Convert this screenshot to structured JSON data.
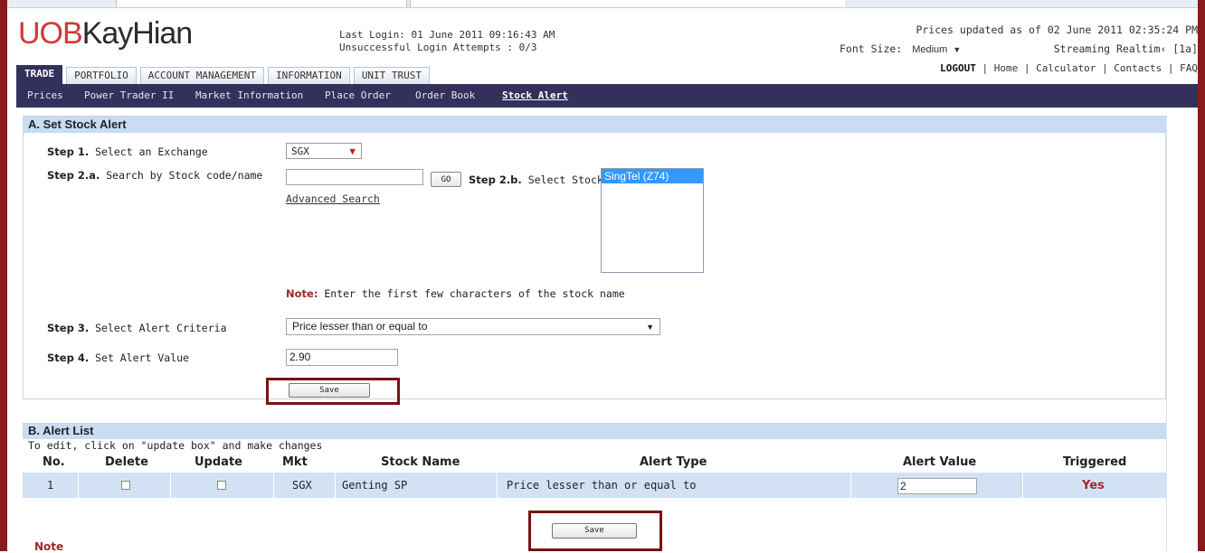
{
  "header": {
    "logo_part1": "UOB",
    "logo_part2": "KayHian",
    "last_login": "Last Login: 01 June 2011 09:16:43 AM",
    "unsuccessful": "Unsuccessful Login Attempts : 0/3",
    "prices_updated": "Prices updated as of 02 June 2011 02:35:24 PM",
    "font_size_label": "Font Size:",
    "font_size_value": "Medium",
    "streaming": "Streaming Realtim‹ [1a]",
    "links": {
      "logout": "LOGOUT",
      "home": "Home",
      "calculator": "Calculator",
      "contacts": "Contacts",
      "faq": "FAQ"
    }
  },
  "tabs": [
    "TRADE",
    "PORTFOLIO",
    "ACCOUNT MANAGEMENT",
    "INFORMATION",
    "UNIT TRUST"
  ],
  "subnav": [
    "Prices",
    "Power Trader II",
    "Market Information",
    "Place Order",
    "Order Book",
    "Stock Alert"
  ],
  "section_a": {
    "title": "A. Set Stock Alert",
    "step1_b": "Step 1.",
    "step1": " Select an Exchange",
    "exchange": "SGX",
    "step2a_b": "Step 2.a.",
    "step2a": " Search by Stock code/name",
    "go": "GO",
    "advanced": "Advanced Search",
    "step2b_b": "Step 2.b.",
    "step2b": " Select Stock",
    "stock_option": "SingTel (Z74)",
    "note_b": "Note:",
    "note": " Enter the first few characters of the stock name",
    "step3_b": "Step 3.",
    "step3": " Select Alert Criteria",
    "criteria": "Price lesser than or equal to",
    "step4_b": "Step 4.",
    "step4": " Set Alert Value",
    "alert_value": "2.90",
    "save": "Save"
  },
  "section_b": {
    "title": "B. Alert List",
    "subtitle": "To edit, click on \"update box\" and make changes",
    "columns": [
      "No.",
      "Delete",
      "Update",
      "Mkt",
      "Stock Name",
      "Alert Type",
      "Alert Value",
      "Triggered"
    ],
    "row": {
      "no": "1",
      "mkt": "SGX",
      "stock": "Genting SP",
      "type": "Price lesser than or equal to",
      "value": "2",
      "triggered": "Yes"
    },
    "save": "Save",
    "note": "Note"
  }
}
